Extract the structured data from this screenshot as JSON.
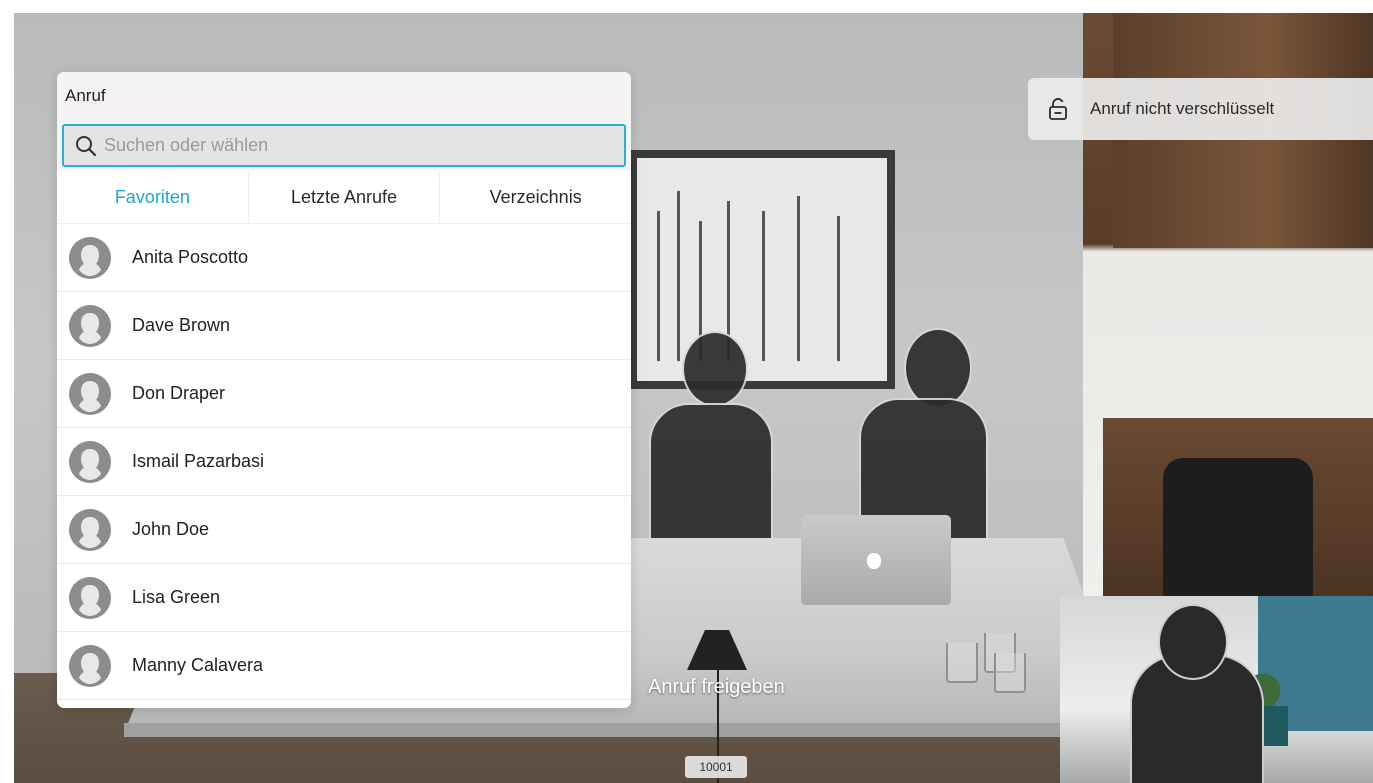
{
  "call_panel": {
    "title": "Anruf",
    "search": {
      "placeholder": "Suchen oder wählen",
      "value": ""
    },
    "tabs": [
      {
        "label": "Favoriten",
        "active": true
      },
      {
        "label": "Letzte Anrufe",
        "active": false
      },
      {
        "label": "Verzeichnis",
        "active": false
      }
    ],
    "contacts": [
      {
        "name": "Anita Poscotto"
      },
      {
        "name": "Dave Brown"
      },
      {
        "name": "Don Draper"
      },
      {
        "name": "Ismail Pazarbasi"
      },
      {
        "name": "John Doe"
      },
      {
        "name": "Lisa Green"
      },
      {
        "name": "Manny Calavera"
      }
    ]
  },
  "encryption_status": {
    "label": "Anruf nicht verschlüsselt",
    "icon": "unlocked-icon"
  },
  "share_label": "Anruf freigeben",
  "call_number": "10001",
  "colors": {
    "accent": "#1aa8d2",
    "search_border": "#2ab0d6",
    "avatar": "#8c8c8c",
    "panel_background": "#ffffff",
    "header_background": "#f4f4f4"
  }
}
